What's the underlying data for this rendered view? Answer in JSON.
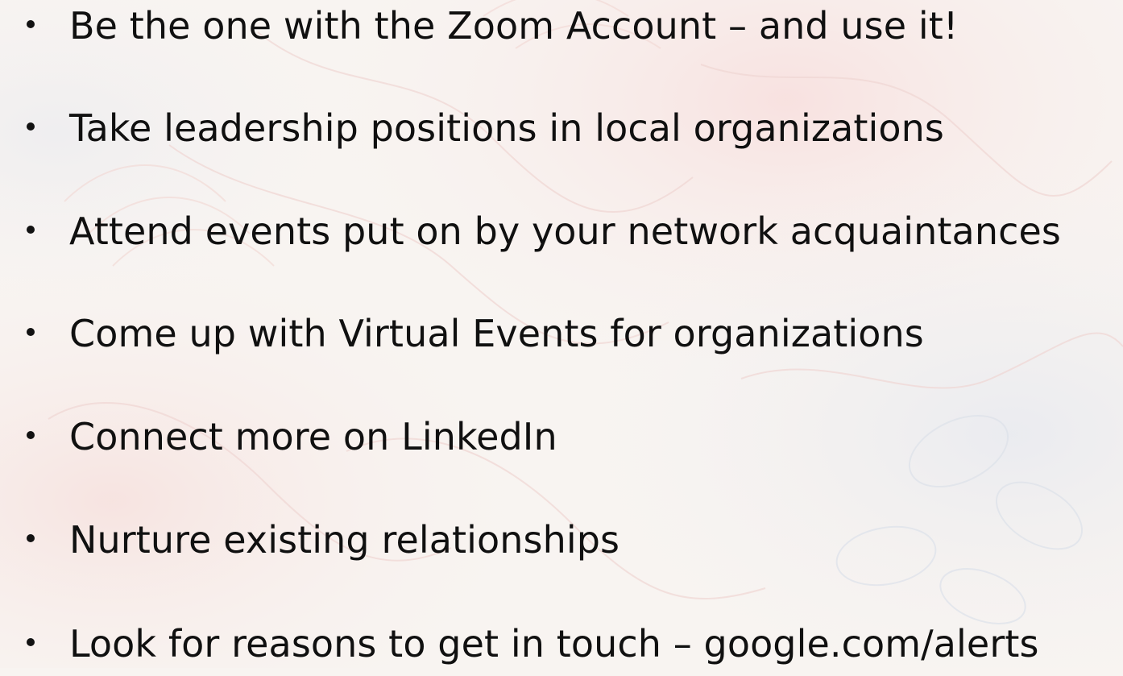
{
  "slide": {
    "bullets": [
      {
        "text": "Be the one with the Zoom Account – and use it!"
      },
      {
        "text": "Take leadership positions in local organizations"
      },
      {
        "text": "Attend events put on by your network acquaintances"
      },
      {
        "text": "Come up with Virtual Events for organizations"
      },
      {
        "text": "Connect more on LinkedIn"
      },
      {
        "text": "Nurture existing relationships"
      },
      {
        "text": "Look for reasons to get in touch – google.com/alerts"
      }
    ]
  },
  "colors": {
    "background": "#f8f4f1",
    "text": "#101010",
    "pattern_warm": "#f3d3cf",
    "pattern_cool": "#dde2ea"
  },
  "icons": {
    "bullet": "bullet-dot-icon"
  }
}
